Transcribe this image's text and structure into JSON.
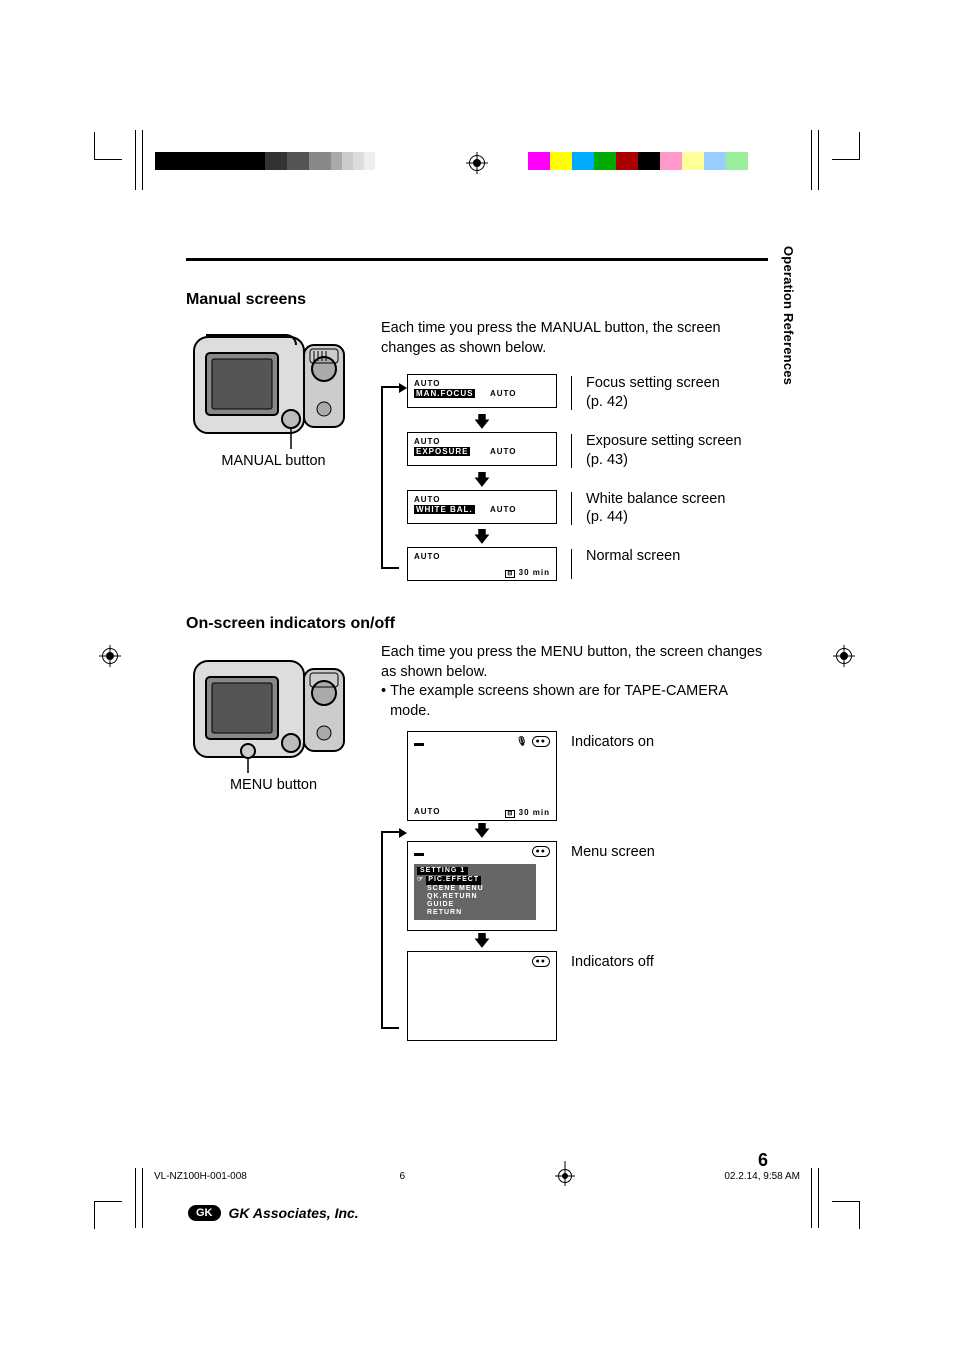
{
  "side_tab": "Operation References",
  "section1": {
    "title": "Manual screens",
    "caption": "MANUAL button",
    "intro": "Each time you press the MANUAL button, the screen changes as shown below.",
    "screens": [
      {
        "auto": "AUTO",
        "label": "MAN.FOCUS",
        "value": "AUTO",
        "desc": "Focus setting screen",
        "desc2": "(p. 42)"
      },
      {
        "auto": "AUTO",
        "label": "EXPOSURE",
        "value": "AUTO",
        "desc": "Exposure setting screen",
        "desc2": "(p. 43)"
      },
      {
        "auto": "AUTO",
        "label": "WHITE BAL.",
        "value": "AUTO",
        "desc": "White balance screen",
        "desc2": "(p. 44)"
      },
      {
        "auto": "AUTO",
        "bottom_right": "30 min",
        "desc": "Normal screen",
        "desc2": ""
      }
    ]
  },
  "section2": {
    "title": "On-screen indicators on/off",
    "caption": "MENU button",
    "intro": "Each time you press the MENU button, the screen changes as shown below.",
    "bullet": "The example screens shown are for TAPE-CAMERA mode.",
    "screens": [
      {
        "auto_bl": "AUTO",
        "bottom_right": "30 min",
        "tr_cc": "●●",
        "mic": "🎤",
        "batt": "▬",
        "desc": "Indicators on"
      },
      {
        "batt": "▬",
        "tr_cc": "●●",
        "menu": {
          "header": "SETTING 1",
          "items": [
            "PIC.EFFECT",
            "SCENE MENU",
            "QK.RETURN",
            "GUIDE",
            "RETURN"
          ]
        },
        "desc": "Menu screen"
      },
      {
        "tr_cc": "●●",
        "desc": "Indicators off"
      }
    ]
  },
  "page_number": "6",
  "footer": {
    "doc_id": "VL-NZ100H-001-008",
    "page": "6",
    "timestamp": "02.2.14, 9:58 AM"
  },
  "associates": "GK Associates, Inc.",
  "associates_logo": "GK"
}
